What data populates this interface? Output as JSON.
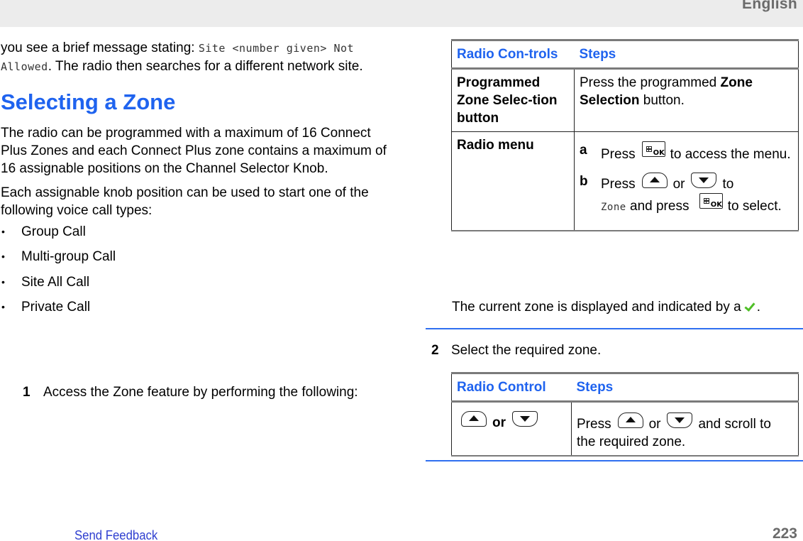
{
  "header": {
    "language": "English"
  },
  "left": {
    "intro": {
      "prefix": "you see a brief message stating: ",
      "code": "Site <number given> Not Allowed",
      "suffix": ". The radio then searches for a different network site."
    },
    "heading": "Selecting a Zone",
    "paragraph1": "The radio can be programmed with a maximum of 16 Connect Plus Zones and each Connect Plus zone contains a maximum of 16 assignable positions on the Channel Selector Knob.",
    "paragraph2": "Each assignable knob position can be used to start one of the following voice call types:",
    "call_types": [
      "Group Call",
      "Multi-group Call",
      "Site All Call",
      "Private Call"
    ],
    "bullet": "•",
    "step1": {
      "number": "1",
      "text": "Access the Zone feature by performing the following:"
    }
  },
  "table1": {
    "headers": [
      "Radio Con-trols",
      "Steps"
    ],
    "rows": [
      {
        "control": "Programmed Zone Selec-tion button",
        "steps_prefix": "Press the programmed ",
        "steps_bold": "Zone Selection",
        "steps_suffix": " button."
      },
      {
        "control": "Radio menu",
        "sub_a": {
          "label": "a",
          "press": "Press",
          "icon": "menu-ok-icon",
          "rest": "to access the menu."
        },
        "sub_b": {
          "label": "b",
          "press": "Press",
          "or": "or",
          "to": "to",
          "code": "Zone",
          "and_press": " and press ",
          "to2": "to select."
        }
      }
    ]
  },
  "note": {
    "text": "The current zone is displayed and indicated by a",
    "suffix": ".",
    "icon": "checkmark-icon"
  },
  "step2": {
    "number": "2",
    "text": "Select the required zone."
  },
  "table2": {
    "headers": [
      "Radio Control",
      "Steps"
    ],
    "row": {
      "control_or": "or",
      "press": "Press",
      "or": "or",
      "rest": "and scroll to the required zone."
    }
  },
  "icons": {
    "ok_label": "OK"
  },
  "footer": {
    "feedback_link": "Send Feedback",
    "page_number": "223"
  },
  "colors": {
    "accent": "#1f63ef",
    "separator": "#2f6ff0",
    "check": "#4fbf26",
    "header_bg": "#ececec"
  }
}
